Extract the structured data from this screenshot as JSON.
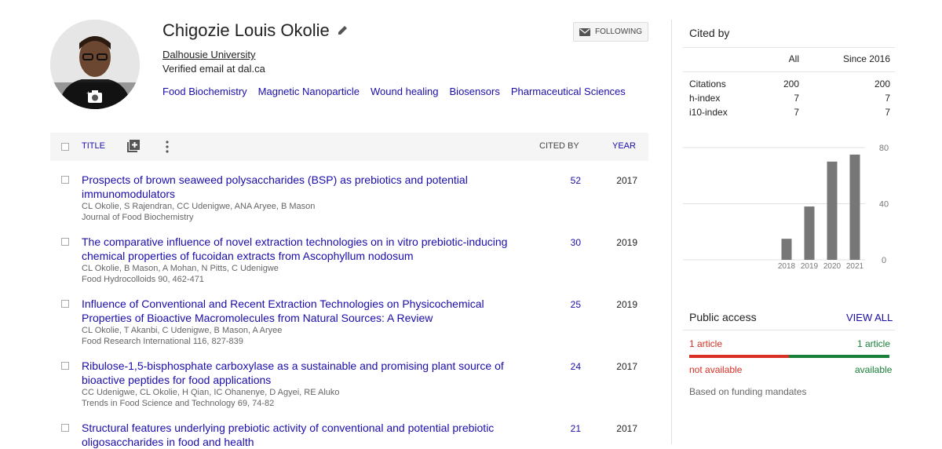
{
  "profile": {
    "name": "Chigozie Louis Okolie",
    "affiliation": "Dalhousie University",
    "email": "Verified email at dal.ca",
    "interests": [
      "Food Biochemistry",
      "Magnetic Nanoparticle",
      "Wound healing",
      "Biosensors",
      "Pharmaceutical Sciences"
    ],
    "follow_label": "FOLLOWING"
  },
  "table": {
    "title_header": "TITLE",
    "cited_header": "CITED BY",
    "year_header": "YEAR",
    "rows": [
      {
        "title": "Prospects of brown seaweed polysaccharides (BSP) as prebiotics and potential immunomodulators",
        "authors": "CL Okolie, S Rajendran, CC Udenigwe, ANA Aryee, B Mason",
        "venue": "Journal of Food Biochemistry",
        "cited": "52",
        "year": "2017"
      },
      {
        "title": "The comparative influence of novel extraction technologies on in vitro prebiotic-inducing chemical properties of fucoidan extracts from Ascophyllum nodosum",
        "authors": "CL Okolie, B Mason, A Mohan, N Pitts, C Udenigwe",
        "venue": "Food Hydrocolloids 90, 462-471",
        "cited": "30",
        "year": "2019"
      },
      {
        "title": "Influence of Conventional and Recent Extraction Technologies on Physicochemical Properties of Bioactive Macromolecules from Natural Sources: A Review",
        "authors": "CL Okolie, T Akanbi, C Udenigwe, B Mason, A Aryee",
        "venue": "Food Research International 116, 827-839",
        "cited": "25",
        "year": "2019"
      },
      {
        "title": "Ribulose-1,5-bisphosphate carboxylase as a sustainable and promising plant source of bioactive peptides for food applications",
        "authors": "CC Udenigwe, CL Okolie, H Qian, IC Ohanenye, D Agyei, RE Aluko",
        "venue": "Trends in Food Science and Technology 69, 74-82",
        "cited": "24",
        "year": "2017"
      },
      {
        "title": "Structural features underlying prebiotic activity of conventional and potential prebiotic oligosaccharides in food and health",
        "authors": "",
        "venue": "",
        "cited": "21",
        "year": "2017"
      }
    ]
  },
  "cited_by": {
    "title": "Cited by",
    "col_all": "All",
    "col_since": "Since 2016",
    "rows": [
      {
        "label": "Citations",
        "all": "200",
        "since": "200"
      },
      {
        "label": "h-index",
        "all": "7",
        "since": "7"
      },
      {
        "label": "i10-index",
        "all": "7",
        "since": "7"
      }
    ]
  },
  "chart_data": {
    "type": "bar",
    "categories": [
      "2018",
      "2019",
      "2020",
      "2021"
    ],
    "values": [
      15,
      38,
      70,
      75
    ],
    "ylim": [
      0,
      80
    ],
    "yticks": [
      "80",
      "40",
      "0"
    ],
    "bar_color": "#777777"
  },
  "public_access": {
    "title": "Public access",
    "view_all": "VIEW ALL",
    "not_available_count": "1 article",
    "available_count": "1 article",
    "not_available_label": "not available",
    "available_label": "available",
    "note": "Based on funding mandates"
  }
}
